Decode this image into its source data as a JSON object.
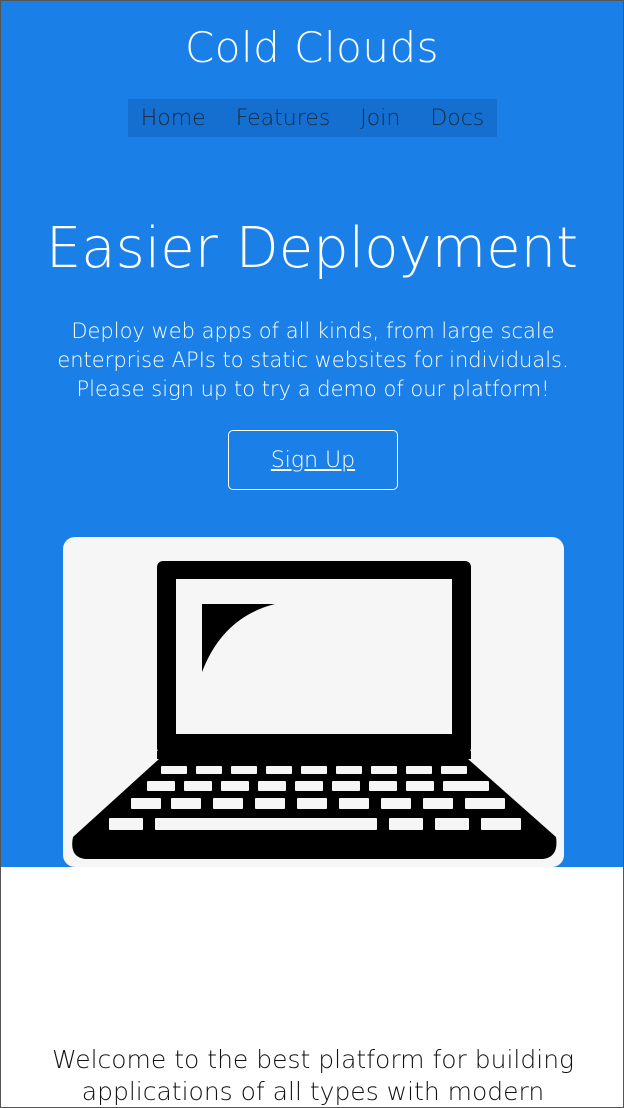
{
  "header": {
    "site_title": "Cold Clouds",
    "nav": [
      {
        "label": "Home"
      },
      {
        "label": "Features"
      },
      {
        "label": "Join"
      },
      {
        "label": "Docs"
      }
    ]
  },
  "hero": {
    "headline": "Easier Deployment",
    "lead": "Deploy web apps of all kinds, from large scale enterprise APIs to static websites for individuals. Please sign up to try a demo of our platform!",
    "signup_label": "Sign Up",
    "image_icon": "laptop-icon"
  },
  "intro": {
    "text": "Welcome to the best platform for building applications of all types with modern"
  },
  "colors": {
    "hero_background": "#1a80e8",
    "nav_background": "#156fd0",
    "text_light": "#ffffff",
    "text_dark": "#111111"
  }
}
